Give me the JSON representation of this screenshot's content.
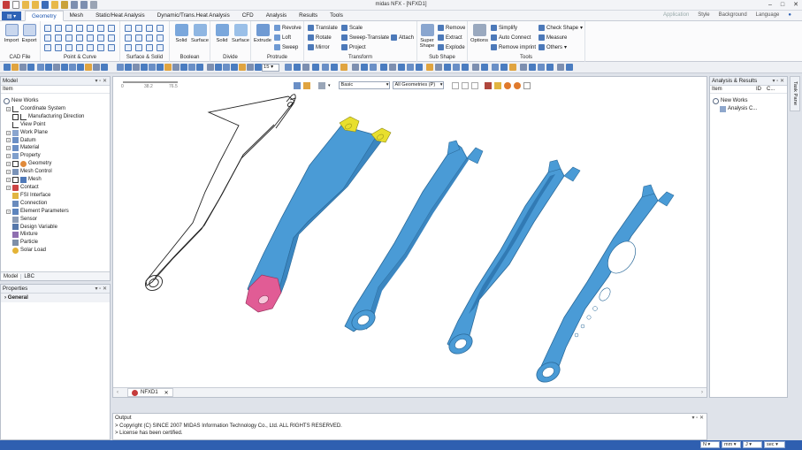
{
  "window": {
    "title": "midas NFX - [NFXD1]"
  },
  "tabs": [
    "Geometry",
    "Mesh",
    "Static/Heat Analysis",
    "Dynamic/Trans.Heat Analysis",
    "CFD",
    "Analysis",
    "Results",
    "Tools"
  ],
  "tab_right": [
    "Application",
    "Style",
    "Background",
    "Language"
  ],
  "ribbon": {
    "groups": [
      "CAD File",
      "Point & Curve",
      "Surface & Solid",
      "Boolean",
      "Divide",
      "Protrude",
      "Transform",
      "Sub Shape",
      "Tools"
    ],
    "cad": {
      "import": "Import",
      "export": "Export"
    },
    "boolean": {
      "solid": "Solid",
      "surface": "Surface"
    },
    "divide": {
      "solid": "Solid",
      "surface": "Surface"
    },
    "protrude": {
      "extrude": "Extrude",
      "revolve": "Revolve",
      "loft": "Loft",
      "sweep": "Sweep"
    },
    "transform": {
      "translate": "Translate",
      "rotate": "Rotate",
      "mirror": "Mirror",
      "scale": "Scale",
      "sweep_translate": "Sweep-Translate",
      "project": "Project",
      "attach": "Attach"
    },
    "subshape": {
      "super": "Super Shape",
      "remove": "Remove",
      "extract": "Extract",
      "explode": "Explode"
    },
    "tools": {
      "options": "Options",
      "simplify": "Simplify",
      "auto_connect": "Auto Connect",
      "remove_imprint": "Remove imprint",
      "check_shape": "Check Shape",
      "measure": "Measure",
      "others": "Others"
    }
  },
  "toolbar": {
    "zoom_value": "15"
  },
  "model_panel": {
    "title": "Model",
    "col": "Item",
    "items": [
      "New Works",
      "Coordinate System",
      "Manufacturing Direction",
      "View Point",
      "Work Plane",
      "Datum",
      "Material",
      "Property",
      "Geometry",
      "Mesh Control",
      "Mesh",
      "Contact",
      "FSI Interface",
      "Connection",
      "Element Parameters",
      "Sensor",
      "Design Variable",
      "Mixture",
      "Particle",
      "Solar Load"
    ],
    "tabs": [
      "Model",
      "LBC"
    ]
  },
  "properties_panel": {
    "title": "Properties",
    "section": "General"
  },
  "analysis_panel": {
    "title": "Analysis & Results",
    "col_item": "Item",
    "col_id": "ID",
    "col_c": "C...",
    "items": [
      "New Works",
      "Analysis C..."
    ]
  },
  "side_tab": "Task Pane",
  "viewport": {
    "scale_labels": [
      "0",
      "38.2",
      "76.5"
    ],
    "view_select": "Basic",
    "geom_select": "All Geometries (P)",
    "doc_tab": "NFXD1"
  },
  "output": {
    "title": "Output",
    "lines": [
      "> Copyright (C) SINCE 2007 MIDAS Information Technology Co., Ltd. ALL RIGHTS RESERVED.",
      "> License has been certified."
    ]
  },
  "status": {
    "fields": [
      "N",
      "mm",
      "J",
      "sec"
    ]
  },
  "colors": {
    "part": "#4a9bd6",
    "highlight_yellow": "#e8df2e",
    "highlight_pink": "#e15c95",
    "accent": "#2f5fb0"
  }
}
